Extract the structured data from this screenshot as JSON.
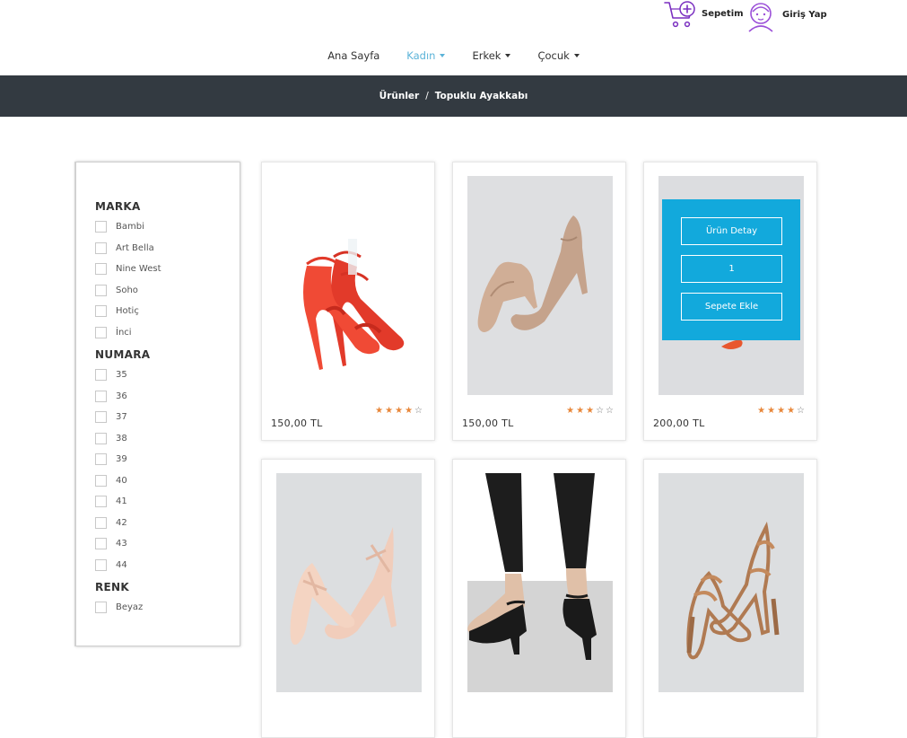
{
  "header": {
    "cart_label": "Sepetim",
    "login_label": "Giriş Yap",
    "cart_icon_color": "#7a2fc0",
    "login_icon_color": "#9b4fd8"
  },
  "nav": {
    "items": [
      {
        "label": "Ana Sayfa",
        "dropdown": false,
        "active": false
      },
      {
        "label": "Kadın",
        "dropdown": true,
        "active": true
      },
      {
        "label": "Erkek",
        "dropdown": true,
        "active": false
      },
      {
        "label": "Çocuk",
        "dropdown": true,
        "active": false
      }
    ],
    "active_color": "#5bb3d8"
  },
  "breadcrumb": {
    "parent": "Ürünler",
    "separator": "/",
    "current": "Topuklu Ayakkabı"
  },
  "filters": {
    "brand": {
      "title": "MARKA",
      "items": [
        "Bambi",
        "Art Bella",
        "Nine West",
        "Soho",
        "Hotiç",
        "İnci"
      ]
    },
    "size": {
      "title": "NUMARA",
      "items": [
        "35",
        "36",
        "37",
        "38",
        "39",
        "40",
        "41",
        "42",
        "43",
        "44"
      ]
    },
    "color": {
      "title": "RENK",
      "items": [
        "Beyaz"
      ]
    }
  },
  "products": [
    {
      "price": "150,00 TL",
      "rating": 4,
      "max_rating": 5,
      "image": "red-strappy-heel",
      "bg": "#ffffff"
    },
    {
      "price": "150,00 TL",
      "rating": 3,
      "max_rating": 5,
      "image": "nude-t-strap-pump",
      "bg": "#dedfe1"
    },
    {
      "price": "200,00 TL",
      "rating": 4,
      "max_rating": 5,
      "image": "orange-heel-hovered",
      "bg": "#dcdde0"
    },
    {
      "price": "",
      "rating": 0,
      "max_rating": 5,
      "image": "nude-cross-strap-heel",
      "bg": "#dcdee0"
    },
    {
      "price": "",
      "rating": 0,
      "max_rating": 5,
      "image": "black-block-heel-on-model",
      "bg": "#d4d4d4"
    },
    {
      "price": "",
      "rating": 0,
      "max_rating": 5,
      "image": "bronze-metallic-strappy-heel",
      "bg": "#dcdee0"
    }
  ],
  "hover_overlay": {
    "detail_label": "Ürün Detay",
    "quantity": "1",
    "add_to_cart_label": "Sepete Ekle",
    "color": "#12a9dc"
  },
  "star_full": "★",
  "star_empty": "☆",
  "accent_color": "#e8873a"
}
